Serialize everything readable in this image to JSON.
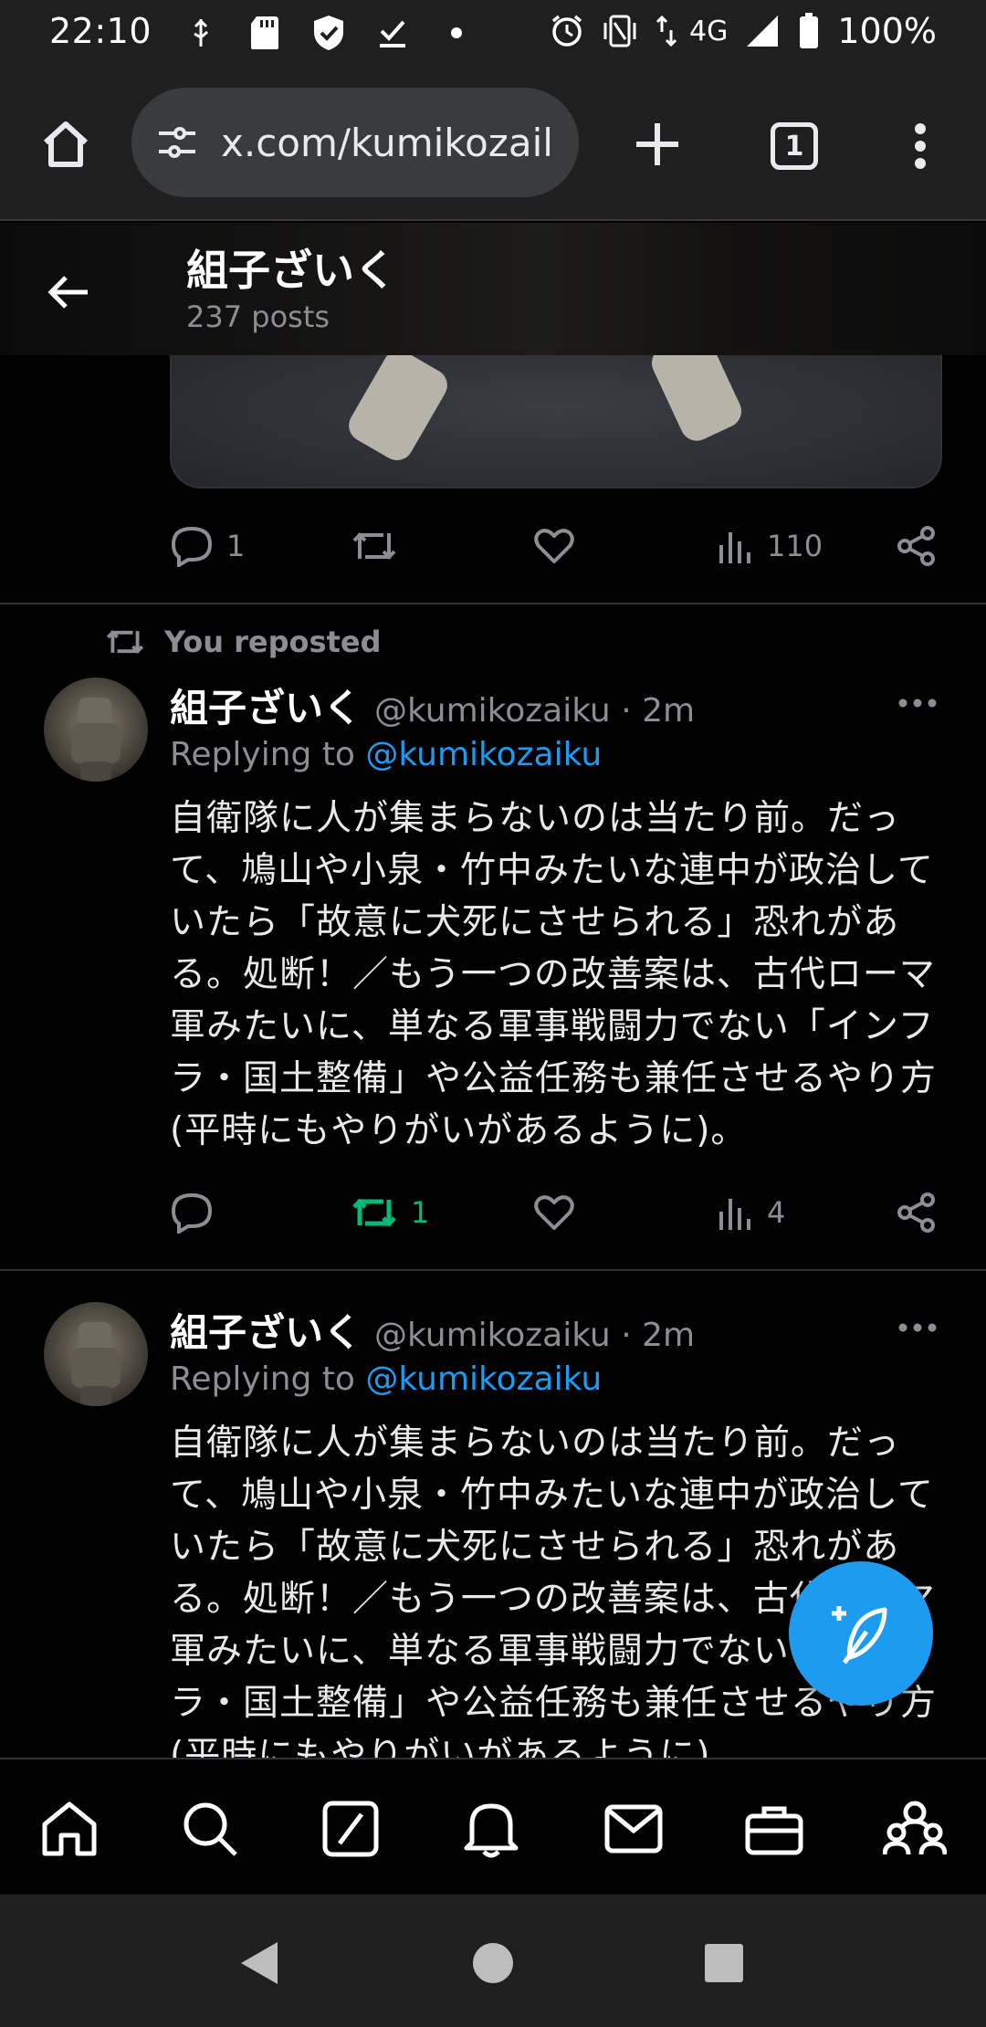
{
  "status_bar": {
    "time": "22:10",
    "network": "4G",
    "battery": "100%",
    "icons": [
      "usb-icon",
      "sd-card-icon",
      "shield-icon",
      "download-done-icon",
      "dot-icon",
      "alarm-icon",
      "vibrate-icon",
      "data-arrows-icon",
      "signal-icon",
      "battery-icon"
    ]
  },
  "browser": {
    "url": "x.com/kumikozail",
    "tab_count": "1"
  },
  "profile": {
    "name": "組子ざいく",
    "posts": "237 posts"
  },
  "first_tweet_actions": {
    "replies": "1",
    "retweets": "",
    "likes": "",
    "views": "110"
  },
  "tweets": [
    {
      "repost_label": "You reposted",
      "name": "組子ざいく",
      "handle": "@kumikozaiku · 2m",
      "replying_prefix": "Replying to ",
      "replying_to": "@kumikozaiku",
      "body": "自衛隊に人が集まらないのは当たり前。だって、鳩山や小泉・竹中みたいな連中が政治していたら「故意に犬死にさせられる」恐れがある。処断！／もう一つの改善案は、古代ローマ軍みたいに、単なる軍事戦闘力でない「インフラ・国土整備」や公益任務も兼任させるやり方(平時にもやりがいがあるように)。",
      "replies": "",
      "retweets": "1",
      "likes": "",
      "views": "4"
    },
    {
      "name": "組子ざいく",
      "handle": "@kumikozaiku · 2m",
      "replying_prefix": "Replying to ",
      "replying_to": "@kumikozaiku",
      "body": "自衛隊に人が集まらないのは当たり前。だって、鳩山や小泉・竹中みたいな連中が政治していたら「故意に犬死にさせられる」恐れがある。処断！／もう一つの改善案は、古代ローマ軍みたいに、単なる軍事戦闘力でない「インフラ・国土整備」や公益任務も兼任させるやり方(平時にもやりがいがあるように)。"
    }
  ],
  "colors": {
    "accent": "#1d9bf0",
    "retweet_active": "#00ba7c",
    "muted": "#8b8f93",
    "background": "#000000"
  },
  "bottom_nav": [
    "home-icon",
    "search-icon",
    "grok-icon",
    "notifications-icon",
    "messages-icon",
    "jobs-icon",
    "communities-icon"
  ],
  "android_nav": [
    "back-icon",
    "home-icon",
    "recents-icon"
  ]
}
